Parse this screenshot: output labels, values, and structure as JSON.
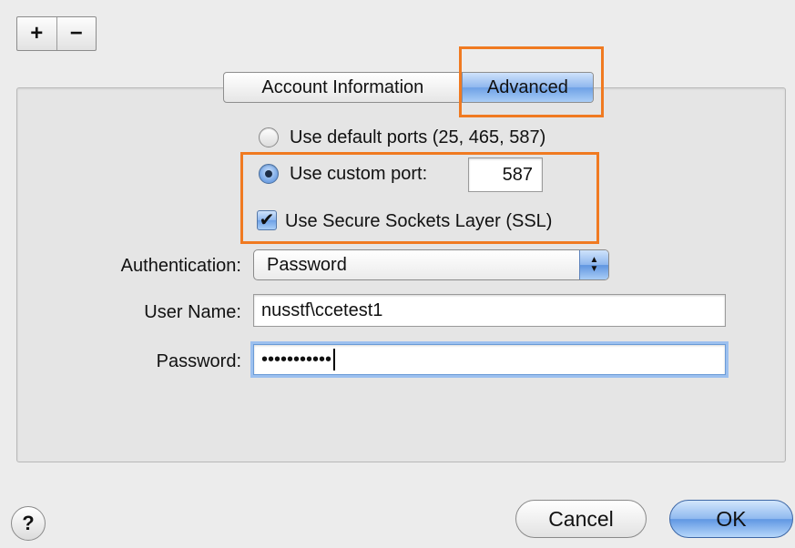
{
  "toolbar": {
    "add_label": "+",
    "remove_label": "−"
  },
  "tabs": [
    {
      "label": "Account Information",
      "selected": false
    },
    {
      "label": "Advanced",
      "selected": true
    }
  ],
  "ports": {
    "default_label": "Use default ports (25, 465, 587)",
    "custom_label": "Use custom port:",
    "custom_value": "587",
    "selected": "custom"
  },
  "ssl": {
    "label": "Use Secure Sockets Layer (SSL)",
    "checked": true,
    "check_glyph": "✔"
  },
  "auth": {
    "label": "Authentication:",
    "value": "Password",
    "arrow_up": "▲",
    "arrow_down": "▼"
  },
  "username": {
    "label": "User Name:",
    "value": "nusstf\\ccetest1"
  },
  "password": {
    "label": "Password:",
    "value": "•••••••••••"
  },
  "help": {
    "label": "?"
  },
  "buttons": {
    "cancel": "Cancel",
    "ok": "OK"
  },
  "colors": {
    "highlight": "#f07a21",
    "accent": "#6ea1e6"
  }
}
